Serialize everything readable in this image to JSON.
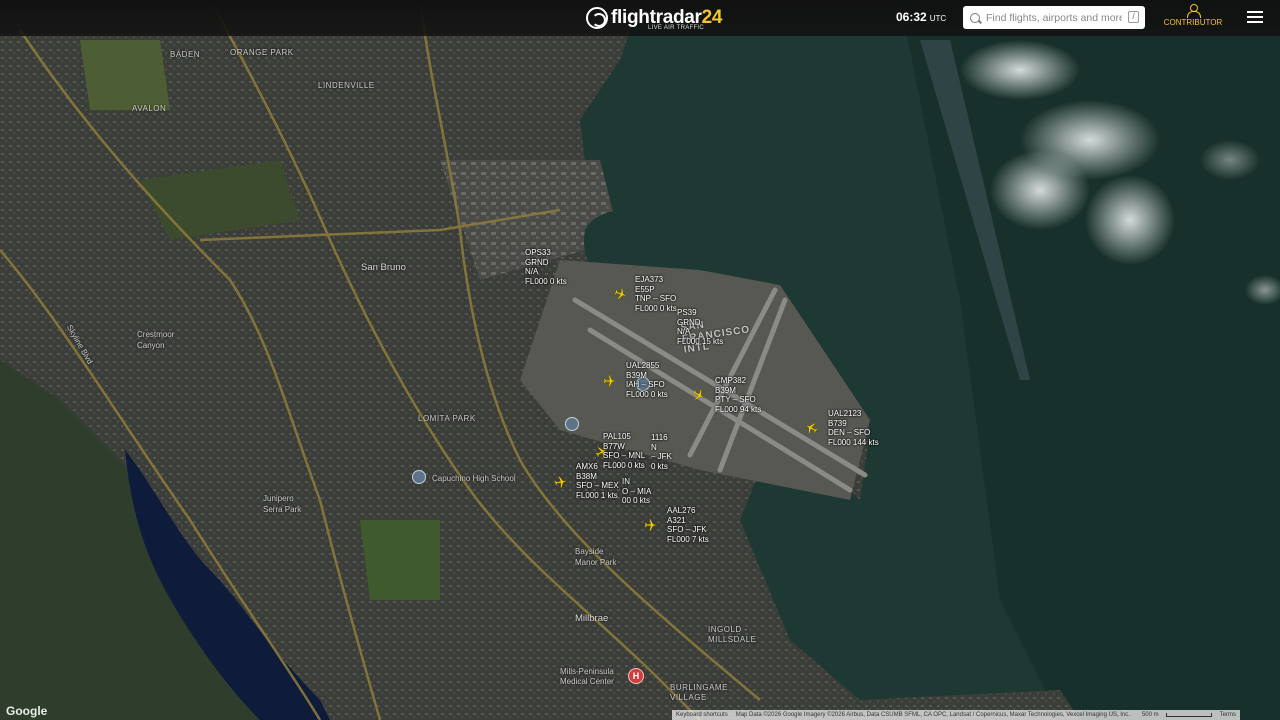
{
  "header": {
    "logo_text": "flightradar",
    "logo_number": "24",
    "logo_tagline": "LIVE AIR TRAFFIC",
    "time": "06:32",
    "time_zone": "UTC",
    "search_placeholder": "Find flights, airports and more",
    "search_shortcut": "/",
    "contributor_label": "CONTRIBUTOR"
  },
  "places": [
    {
      "id": "baden",
      "label": "BADEN"
    },
    {
      "id": "orange-park",
      "label": "ORANGE PARK"
    },
    {
      "id": "lindenville",
      "label": "LINDENVILLE"
    },
    {
      "id": "avalon",
      "label": "AVALON"
    },
    {
      "id": "san-bruno",
      "label": "San Bruno"
    },
    {
      "id": "crestmoor-canyon",
      "label": "Crestmoor\nCanyon"
    },
    {
      "id": "lomita-park",
      "label": "LOMITA PARK"
    },
    {
      "id": "skyline-blvd",
      "label": "Skyline Blvd"
    },
    {
      "id": "junipero-serra-park",
      "label": "Junipero\nSerra Park"
    },
    {
      "id": "capuchino-high-school",
      "label": "Capuchino High School"
    },
    {
      "id": "bayside-manor-park",
      "label": "Bayside\nManor Park"
    },
    {
      "id": "millbrae",
      "label": "Millbrae"
    },
    {
      "id": "ingold-millsdale",
      "label": "INGOLD -\nMILLSDALE"
    },
    {
      "id": "burlingame-village",
      "label": "BURLINGAME\nVILLAGE"
    },
    {
      "id": "mills-peninsula",
      "label": "Mills-Peninsula\nMedical Center"
    },
    {
      "id": "san-francisco-intl",
      "label": "SAN\nFRANCISCO\nINTL"
    }
  ],
  "aircraft": [
    {
      "id": "ops33",
      "callsign": "OPS33",
      "type": "GRND",
      "route": "N/A",
      "alt_speed": "FL000 0 kts",
      "heading": 0,
      "show_icon": false
    },
    {
      "id": "eja373",
      "callsign": "EJA373",
      "type": "E55P",
      "route": "TNP – SFO",
      "alt_speed": "FL000 0 kts",
      "heading": 110,
      "show_icon": true
    },
    {
      "id": "ps39",
      "callsign": "PS39",
      "type": "GRND",
      "route": "N/A",
      "alt_speed": "FL000 15 kts",
      "heading": 0,
      "show_icon": false
    },
    {
      "id": "ual2855",
      "callsign": "UAL2855",
      "type": "B39M",
      "route": "IAH – SFO",
      "alt_speed": "FL000 0 kts",
      "heading": 90,
      "show_icon": true
    },
    {
      "id": "cmp382",
      "callsign": "CMP382",
      "type": "B39M",
      "route": "PTY – SFO",
      "alt_speed": "FL000 94 kts",
      "heading": 120,
      "show_icon": true
    },
    {
      "id": "ual2123",
      "callsign": "UAL2123",
      "type": "B739",
      "route": "DEN – SFO",
      "alt_speed": "FL000 144 kts",
      "heading": 300,
      "show_icon": true
    },
    {
      "id": "pal105",
      "callsign": "PAL105",
      "type": "B77W",
      "route": "SFO – MNL",
      "alt_speed": "FL000 0 kts",
      "heading": 60,
      "show_icon": true
    },
    {
      "id": "x1116",
      "callsign": "1116",
      "type": "N",
      "route": "– JFK",
      "alt_speed": "0 kts",
      "heading": 0,
      "show_icon": false
    },
    {
      "id": "amx6",
      "callsign": "AMX6",
      "type": "B38M",
      "route": "SFO – MEX",
      "alt_speed": "FL000 1 kts",
      "heading": 80,
      "show_icon": true
    },
    {
      "id": "xmia",
      "callsign": "IN",
      "type": "",
      "route": "O – MIA",
      "alt_speed": "00 0 kts",
      "heading": 0,
      "show_icon": false
    },
    {
      "id": "aal276",
      "callsign": "AAL276",
      "type": "A321",
      "route": "SFO – JFK",
      "alt_speed": "FL000 7 kts",
      "heading": 90,
      "show_icon": true
    }
  ],
  "poi_hospital": "H",
  "footer": {
    "google": "Google",
    "keyboard": "Keyboard shortcuts",
    "map_data": "Map Data ©2026 Google Imagery ©2026 Airbus, Data CSUMB SFML, CA OPC, Landsat / Copernicus, Maxar Technologies, Vexcel Imaging US, Inc.",
    "scale": "500 m",
    "terms": "Terms"
  },
  "colors": {
    "aircraft": "#f5d400",
    "accent": "#f5c430",
    "water": "#1d3530",
    "land": "#2c302b"
  }
}
